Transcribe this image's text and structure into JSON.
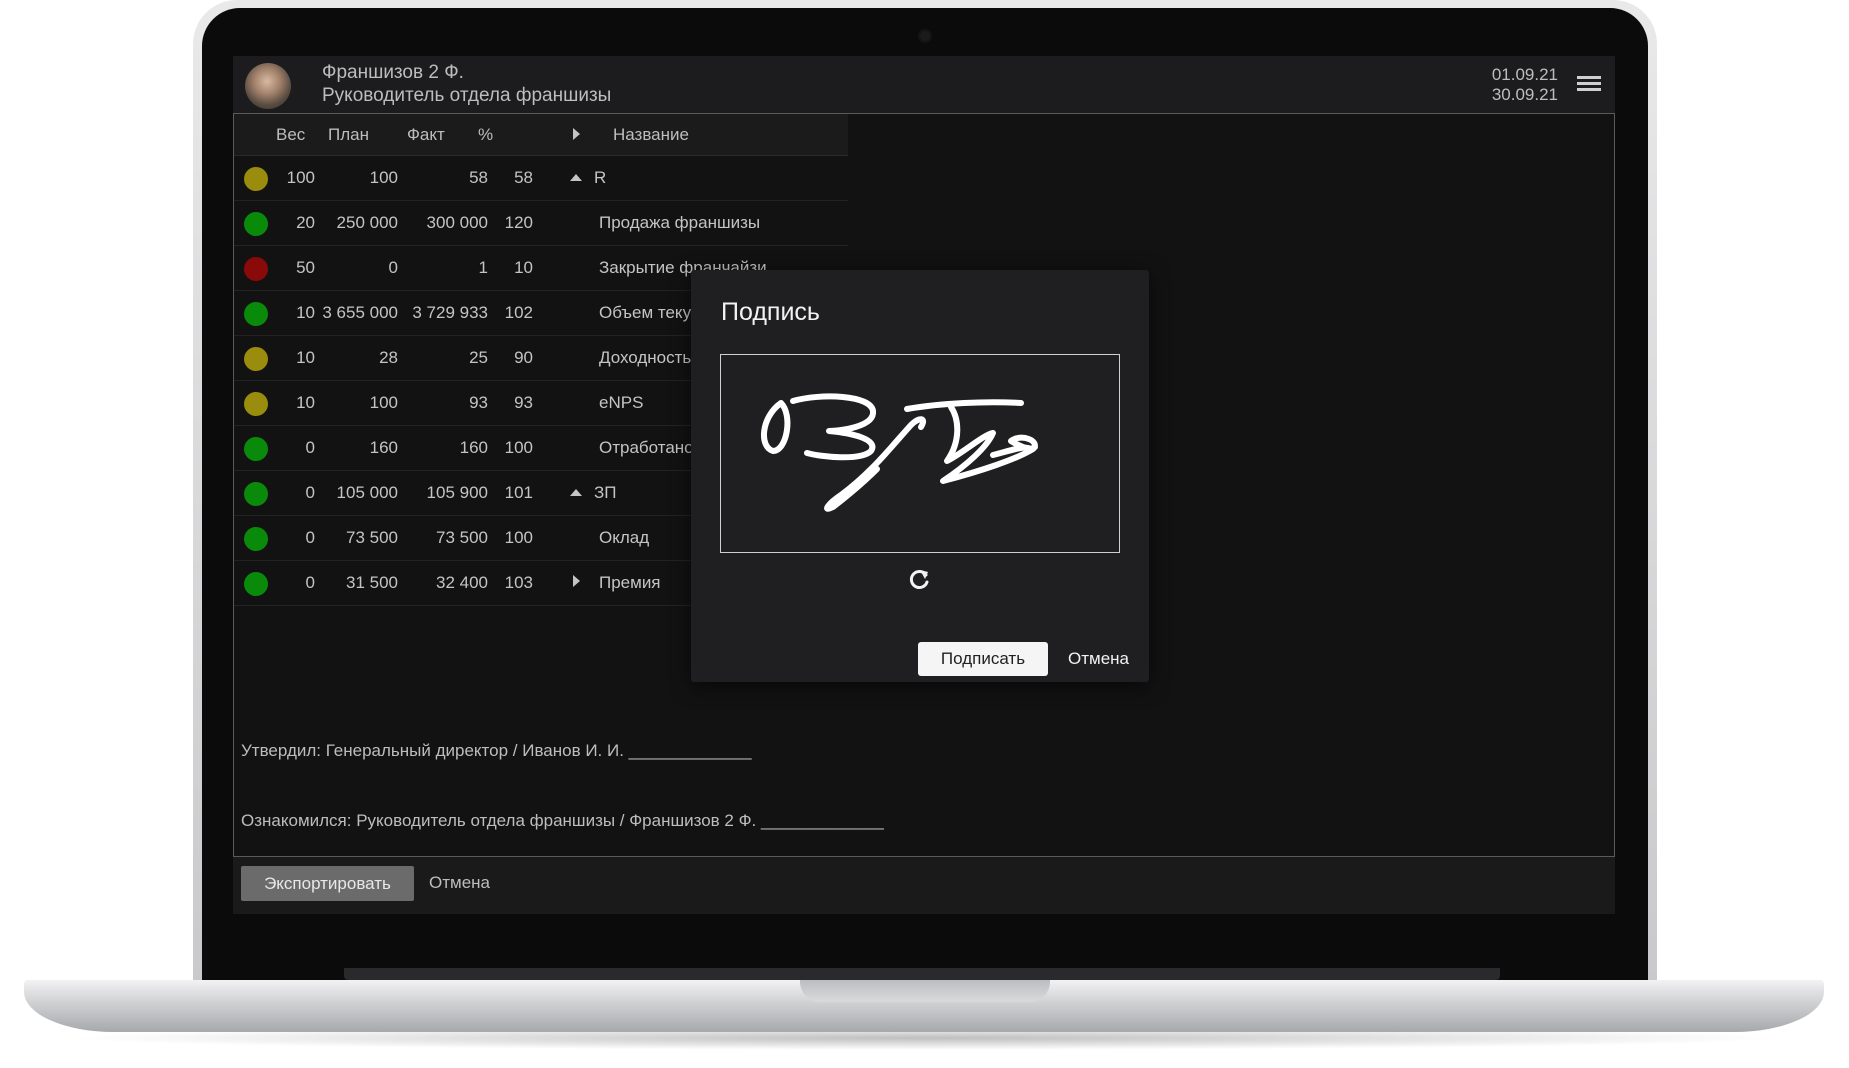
{
  "header": {
    "user_name": "Франшизов 2 Ф.",
    "user_role": "Руководитель отдела франшизы",
    "date_from": "01.09.21",
    "date_to": "30.09.21"
  },
  "table": {
    "headers": {
      "weight": "Вес",
      "plan": "План",
      "fact": "Факт",
      "percent": "%",
      "name": "Название"
    },
    "rows": [
      {
        "status": "yellow",
        "weight": "100",
        "plan": "100",
        "fact": "58",
        "percent": "58",
        "arrow": "up",
        "name": "R"
      },
      {
        "status": "green",
        "weight": "20",
        "plan": "250 000",
        "fact": "300 000",
        "percent": "120",
        "arrow": "",
        "name": "Продажа франшизы"
      },
      {
        "status": "red",
        "weight": "50",
        "plan": "0",
        "fact": "1",
        "percent": "10",
        "arrow": "",
        "name": "Закрытие франчайзи"
      },
      {
        "status": "green",
        "weight": "10",
        "plan": "3 655 000",
        "fact": "3 729 933",
        "percent": "102",
        "arrow": "",
        "name": "Объем текущих"
      },
      {
        "status": "yellow",
        "weight": "10",
        "plan": "28",
        "fact": "25",
        "percent": "90",
        "arrow": "",
        "name": "Доходность"
      },
      {
        "status": "yellow",
        "weight": "10",
        "plan": "100",
        "fact": "93",
        "percent": "93",
        "arrow": "",
        "name": "eNPS"
      },
      {
        "status": "green",
        "weight": "0",
        "plan": "160",
        "fact": "160",
        "percent": "100",
        "arrow": "",
        "name": "Отработано"
      },
      {
        "status": "green",
        "weight": "0",
        "plan": "105 000",
        "fact": "105 900",
        "percent": "101",
        "arrow": "up",
        "name": "ЗП"
      },
      {
        "status": "green",
        "weight": "0",
        "plan": "73 500",
        "fact": "73 500",
        "percent": "100",
        "arrow": "",
        "name": "Оклад"
      },
      {
        "status": "green",
        "weight": "0",
        "plan": "31 500",
        "fact": "32 400",
        "percent": "103",
        "arrow": "right",
        "name": "Премия"
      }
    ]
  },
  "approval_line": "Утвердил: Генеральный директор / Иванов И. И. _____________",
  "familiar_line": "Ознакомился: Руководитель отдела франшизы / Франшизов 2 Ф. _____________",
  "footer": {
    "export_label": "Экспортировать",
    "cancel_label": "Отмена"
  },
  "dialog": {
    "title": "Подпись",
    "sign_label": "Подписать",
    "cancel_label": "Отмена"
  },
  "status_colors": {
    "green": "#0a8a0a",
    "yellow": "#9a8c0c",
    "red": "#8a0a0a"
  }
}
